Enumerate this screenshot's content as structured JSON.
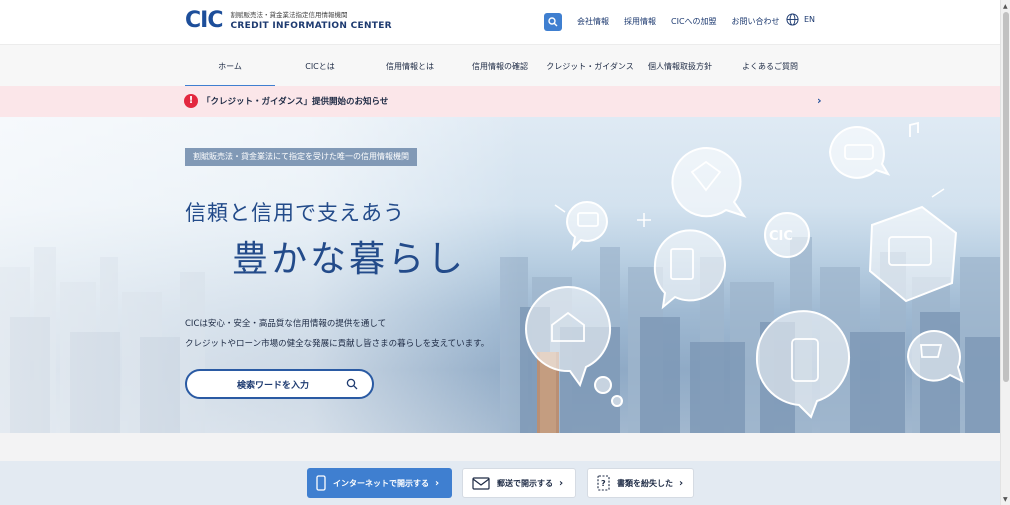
{
  "header": {
    "logo_mark": "CIC",
    "logo_sub": "割賦販売法・貸金業法指定信用情報機関",
    "logo_name": "CREDIT INFORMATION CENTER",
    "links": [
      "会社情報",
      "採用情報",
      "CICへの加盟",
      "お問い合わせ"
    ],
    "lang": "EN"
  },
  "nav": {
    "items": [
      "ホーム",
      "CICとは",
      "信用情報とは",
      "信用情報の確認",
      "クレジット・ガイダンス",
      "個人情報取扱方針",
      "よくあるご質問"
    ],
    "active": "ホーム"
  },
  "notice": {
    "text": "「クレジット・ガイダンス」提供開始のお知らせ",
    "icon": "exclamation-icon"
  },
  "hero": {
    "badge": "割賦販売法・貸金業法にて指定を受けた唯一の信用情報機関",
    "copy1": "信頼と信用で支えあう",
    "copy2": "豊かな暮らし",
    "desc1": "CICは安心・安全・高品質な信用情報の提供を通して",
    "desc2": "クレジットやローン市場の健全な発展に貢献し皆さまの暮らしを支えています。",
    "search_placeholder": "検索ワードを入力",
    "bubble_label": "CIC"
  },
  "bottom": {
    "buttons": [
      "インターネットで開示する",
      "郵送で開示する",
      "書類を紛失した"
    ]
  },
  "colors": {
    "brand": "#1d4e9a",
    "accent": "#3f7fd0",
    "notice_bg": "#fbe6e9",
    "alert": "#e3283f"
  }
}
